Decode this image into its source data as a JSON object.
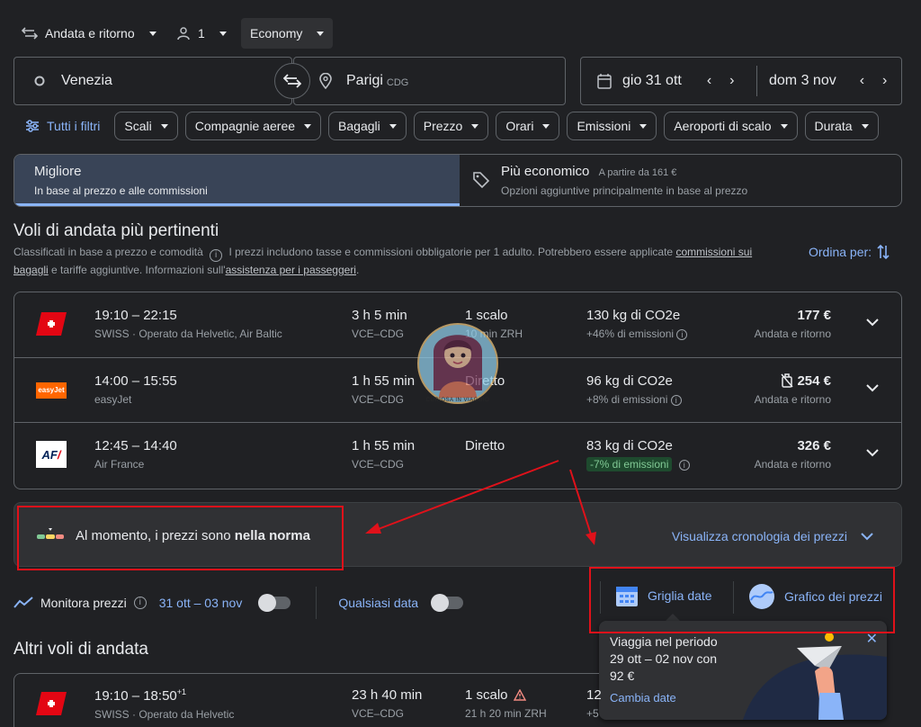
{
  "search": {
    "trip_type": "Andata e ritorno",
    "passengers": "1",
    "cabin": "Economy",
    "origin": "Venezia",
    "destination": "Parigi",
    "destination_code": "CDG",
    "depart_date": "gio 31 ott",
    "return_date": "dom 3 nov"
  },
  "filters": {
    "all_label": "Tutti i filtri",
    "chips": [
      "Scali",
      "Compagnie aeree",
      "Bagagli",
      "Prezzo",
      "Orari",
      "Emissioni",
      "Aeroporti di scalo",
      "Durata"
    ]
  },
  "sort_tabs": {
    "best": {
      "title": "Migliore",
      "subtitle": "In base al prezzo e alle commissioni"
    },
    "cheapest": {
      "title": "Più economico",
      "badge": "A partire da 161 €",
      "subtitle": "Opzioni aggiuntive principalmente in base al prezzo"
    }
  },
  "section": {
    "title": "Voli di andata più pertinenti",
    "note_a": "Classificati in base a prezzo e comodità",
    "note_b": "I prezzi includono tasse e commissioni obbligatorie per 1 adulto. Potrebbero essere applicate",
    "note_link1": "commissioni sui bagagli",
    "note_c": "e tariffe aggiuntive. Informazioni sull'",
    "note_link2": "assistenza per i passeggeri",
    "note_d": ".",
    "sort_label": "Ordina per:"
  },
  "flights": [
    {
      "times": "19:10 – 22:15",
      "airline": "SWISS · Operato da Helvetic, Air Baltic",
      "duration": "3 h 5 min",
      "route": "VCE–CDG",
      "stops": "1 scalo",
      "stop_detail": "10 min ZRH",
      "co2": "130 kg di CO2e",
      "emissions": "+46% di emissioni",
      "price": "177 €",
      "price_note": "Andata e ritorno",
      "logo": "swiss-logo"
    },
    {
      "times": "14:00 – 15:55",
      "airline": "easyJet",
      "duration": "1 h 55 min",
      "route": "VCE–CDG",
      "stops": "Diretto",
      "stop_detail": "",
      "co2": "96 kg di CO2e",
      "emissions": "+8% di emissioni",
      "price": "254 €",
      "price_note": "Andata e ritorno",
      "logo": "easyjet-logo",
      "logo_text": "easyJet"
    },
    {
      "times": "12:45 – 14:40",
      "airline": "Air France",
      "duration": "1 h 55 min",
      "route": "VCE–CDG",
      "stops": "Diretto",
      "stop_detail": "",
      "co2": "83 kg di CO2e",
      "emissions": "-7% di emissioni",
      "price": "326 €",
      "price_note": "Andata e ritorno",
      "logo": "air-france-logo",
      "logo_text": "AF"
    }
  ],
  "price_insight": {
    "text_a": "Al momento, i prezzi sono ",
    "text_b": "nella norma",
    "link": "Visualizza cronologia dei prezzi"
  },
  "tracking": {
    "label": "Monitora prezzi",
    "dates": "31 ott – 03 nov",
    "any_date": "Qualsiasi data",
    "date_grid": "Griglia date",
    "price_graph": "Grafico dei prezzi"
  },
  "tooltip": {
    "line1": "Viaggia nel periodo",
    "line2": "29 ott – 02 nov con",
    "line3": "92 €",
    "link": "Cambia date"
  },
  "other": {
    "title": "Altri voli di andata",
    "flight": {
      "times": "19:10 – 18:50",
      "days_plus": "+1",
      "airline": "SWISS · Operato da Helvetic",
      "duration": "23 h 40 min",
      "route": "VCE–CDG",
      "stops": "1 scalo",
      "stop_detail": "21 h 20 min ZRH",
      "co2_partial": "12",
      "emis_partial": "+5"
    }
  },
  "watermark": "CURIOSA IN VIAGGIO",
  "colors": {
    "bg": "#202124",
    "accent": "#8ab4f8",
    "highlight": "#e0111a",
    "active_tab": "#394457"
  }
}
